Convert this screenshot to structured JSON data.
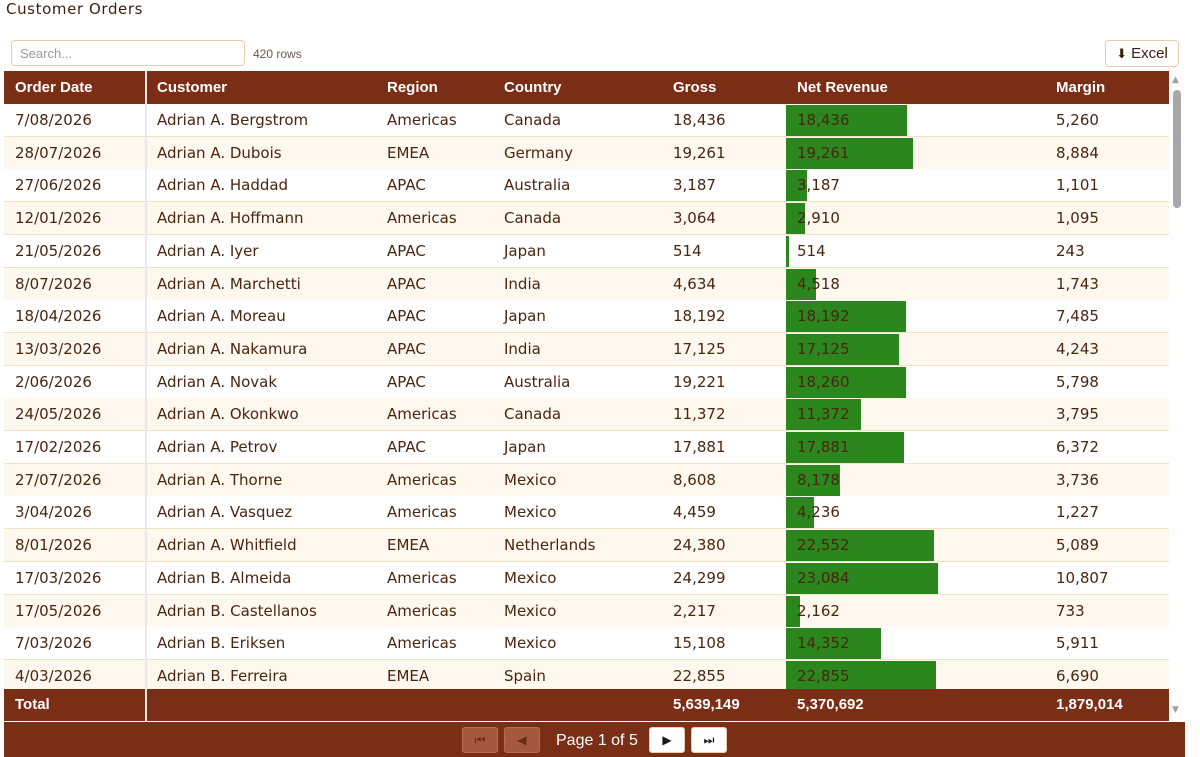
{
  "page": {
    "title": "Customer Orders"
  },
  "toolbar": {
    "search_placeholder": "Search...",
    "row_count": "420 rows",
    "excel_label": "Excel",
    "excel_icon": "download-arrow-icon"
  },
  "columns": [
    "Order Date",
    "Customer",
    "Region",
    "Country",
    "Gross",
    "Net Revenue",
    "Margin"
  ],
  "colors": {
    "header_bg": "#7b2e16",
    "bar": "#2b861d",
    "alt_row": "#fff8ef"
  },
  "bar_max": 24299,
  "rows": [
    {
      "date": "7/08/2026",
      "customer": "Adrian A. Bergstrom",
      "region": "Americas",
      "country": "Canada",
      "gross": "18,436",
      "net": "18,436",
      "net_value": 18436,
      "margin": "5,260"
    },
    {
      "date": "28/07/2026",
      "customer": "Adrian A. Dubois",
      "region": "EMEA",
      "country": "Germany",
      "gross": "19,261",
      "net": "19,261",
      "net_value": 19261,
      "margin": "8,884"
    },
    {
      "date": "27/06/2026",
      "customer": "Adrian A. Haddad",
      "region": "APAC",
      "country": "Australia",
      "gross": "3,187",
      "net": "3,187",
      "net_value": 3187,
      "margin": "1,101"
    },
    {
      "date": "12/01/2026",
      "customer": "Adrian A. Hoffmann",
      "region": "Americas",
      "country": "Canada",
      "gross": "3,064",
      "net": "2,910",
      "net_value": 2910,
      "margin": "1,095"
    },
    {
      "date": "21/05/2026",
      "customer": "Adrian A. Iyer",
      "region": "APAC",
      "country": "Japan",
      "gross": "514",
      "net": "514",
      "net_value": 514,
      "margin": "243"
    },
    {
      "date": "8/07/2026",
      "customer": "Adrian A. Marchetti",
      "region": "APAC",
      "country": "India",
      "gross": "4,634",
      "net": "4,518",
      "net_value": 4518,
      "margin": "1,743"
    },
    {
      "date": "18/04/2026",
      "customer": "Adrian A. Moreau",
      "region": "APAC",
      "country": "Japan",
      "gross": "18,192",
      "net": "18,192",
      "net_value": 18192,
      "margin": "7,485"
    },
    {
      "date": "13/03/2026",
      "customer": "Adrian A. Nakamura",
      "region": "APAC",
      "country": "India",
      "gross": "17,125",
      "net": "17,125",
      "net_value": 17125,
      "margin": "4,243"
    },
    {
      "date": "2/06/2026",
      "customer": "Adrian A. Novak",
      "region": "APAC",
      "country": "Australia",
      "gross": "19,221",
      "net": "18,260",
      "net_value": 18260,
      "margin": "5,798"
    },
    {
      "date": "24/05/2026",
      "customer": "Adrian A. Okonkwo",
      "region": "Americas",
      "country": "Canada",
      "gross": "11,372",
      "net": "11,372",
      "net_value": 11372,
      "margin": "3,795"
    },
    {
      "date": "17/02/2026",
      "customer": "Adrian A. Petrov",
      "region": "APAC",
      "country": "Japan",
      "gross": "17,881",
      "net": "17,881",
      "net_value": 17881,
      "margin": "6,372"
    },
    {
      "date": "27/07/2026",
      "customer": "Adrian A. Thorne",
      "region": "Americas",
      "country": "Mexico",
      "gross": "8,608",
      "net": "8,178",
      "net_value": 8178,
      "margin": "3,736"
    },
    {
      "date": "3/04/2026",
      "customer": "Adrian A. Vasquez",
      "region": "Americas",
      "country": "Mexico",
      "gross": "4,459",
      "net": "4,236",
      "net_value": 4236,
      "margin": "1,227"
    },
    {
      "date": "8/01/2026",
      "customer": "Adrian A. Whitfield",
      "region": "EMEA",
      "country": "Netherlands",
      "gross": "24,380",
      "net": "22,552",
      "net_value": 22552,
      "margin": "5,089"
    },
    {
      "date": "17/03/2026",
      "customer": "Adrian B. Almeida",
      "region": "Americas",
      "country": "Mexico",
      "gross": "24,299",
      "net": "23,084",
      "net_value": 23084,
      "margin": "10,807"
    },
    {
      "date": "17/05/2026",
      "customer": "Adrian B. Castellanos",
      "region": "Americas",
      "country": "Mexico",
      "gross": "2,217",
      "net": "2,162",
      "net_value": 2162,
      "margin": "733"
    },
    {
      "date": "7/03/2026",
      "customer": "Adrian B. Eriksen",
      "region": "Americas",
      "country": "Mexico",
      "gross": "15,108",
      "net": "14,352",
      "net_value": 14352,
      "margin": "5,911"
    },
    {
      "date": "4/03/2026",
      "customer": "Adrian B. Ferreira",
      "region": "EMEA",
      "country": "Spain",
      "gross": "22,855",
      "net": "22,855",
      "net_value": 22855,
      "margin": "6,690"
    }
  ],
  "totals": {
    "label": "Total",
    "gross": "5,639,149",
    "net": "5,370,692",
    "margin": "1,879,014"
  },
  "pager": {
    "info": "Page 1 of 5",
    "first_icon": "first-page-icon",
    "prev_icon": "previous-page-icon",
    "next_icon": "next-page-icon",
    "last_icon": "last-page-icon"
  }
}
